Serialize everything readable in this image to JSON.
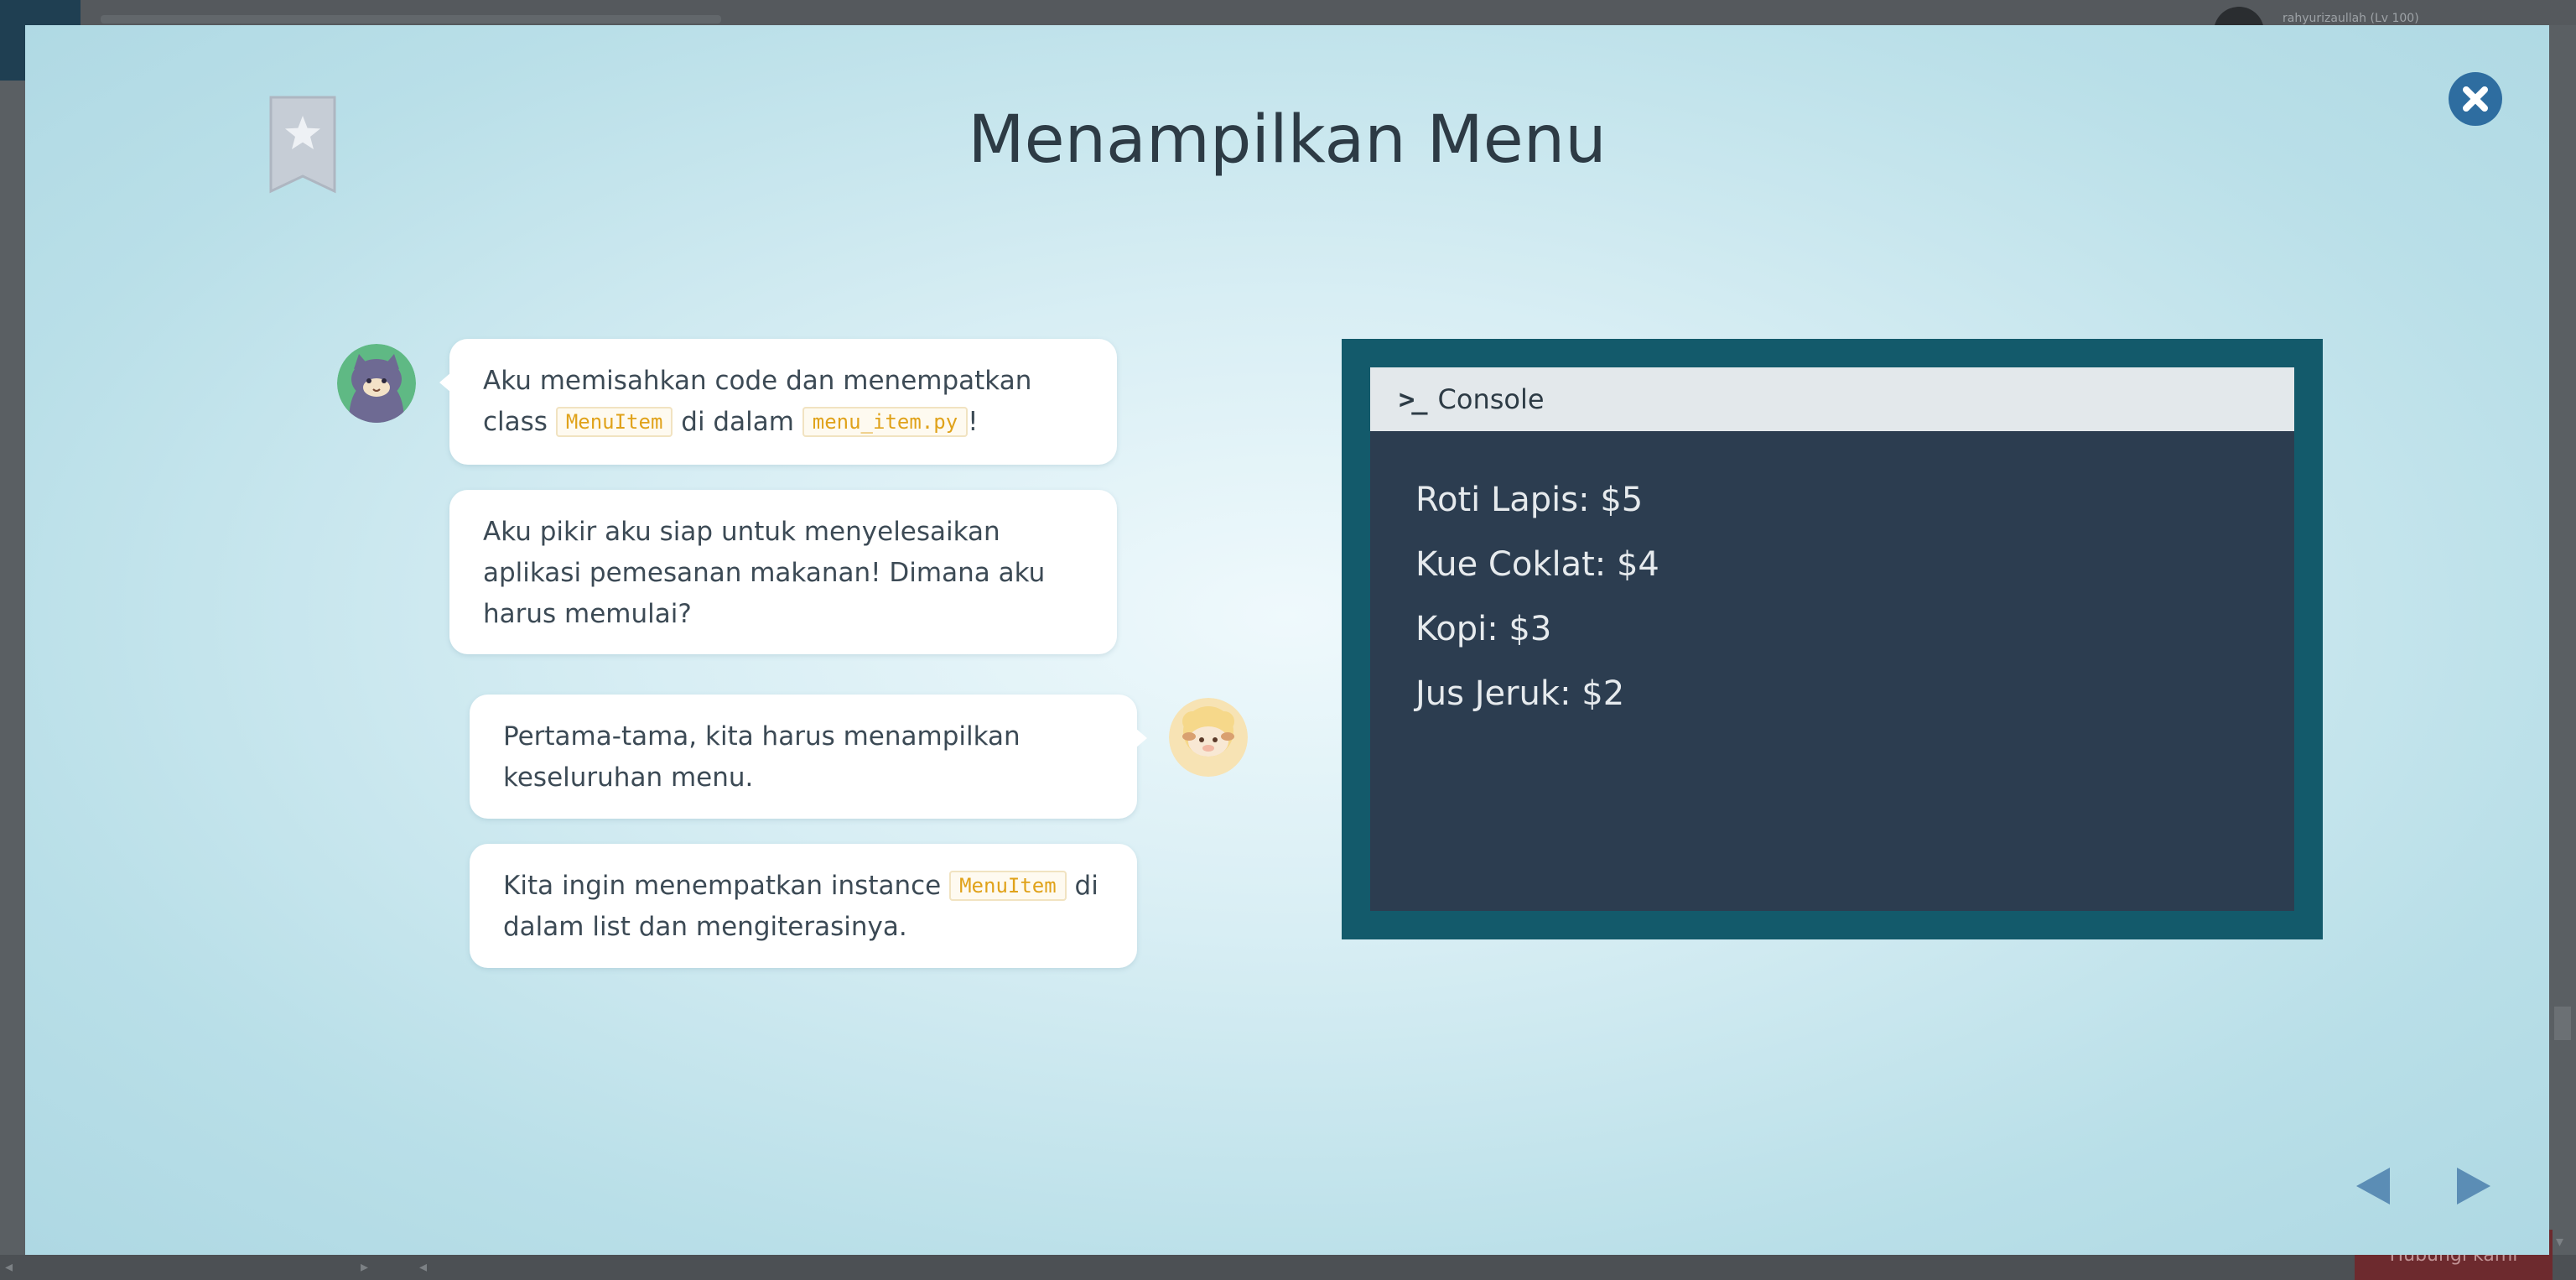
{
  "background": {
    "user_name": "rahyurizaullah (Lv 100)",
    "footer_button": "Hubungi kami"
  },
  "modal": {
    "title": "Menampilkan Menu",
    "bookmark_icon": "star-bookmark-icon",
    "close_icon": "close-circle-icon"
  },
  "chat": {
    "messages": [
      {
        "speaker": "cat",
        "parts": [
          "Aku memisahkan code dan menempatkan class ",
          "MenuItem",
          " di dalam ",
          "menu_item.py",
          "!"
        ]
      },
      {
        "speaker": "cat",
        "text": "Aku pikir aku siap untuk menyelesaikan aplikasi pemesanan makanan! Dimana aku harus memulai?"
      },
      {
        "speaker": "sheep",
        "text": "Pertama-tama, kita harus menampilkan keseluruhan menu."
      },
      {
        "speaker": "sheep",
        "parts": [
          "Kita ingin menempatkan instance ",
          "MenuItem",
          " di dalam list dan mengiterasinya."
        ]
      }
    ]
  },
  "console": {
    "title": "Console",
    "prompt_symbol": ">_",
    "lines": [
      "Roti Lapis: $5",
      "Kue Coklat: $4",
      "Kopi: $3",
      "Jus Jeruk: $2"
    ]
  },
  "colors": {
    "accent_blue": "#2e6da0",
    "console_frame": "#135a6b",
    "console_bg": "#2c3d50",
    "code_text": "#e0a21a"
  }
}
